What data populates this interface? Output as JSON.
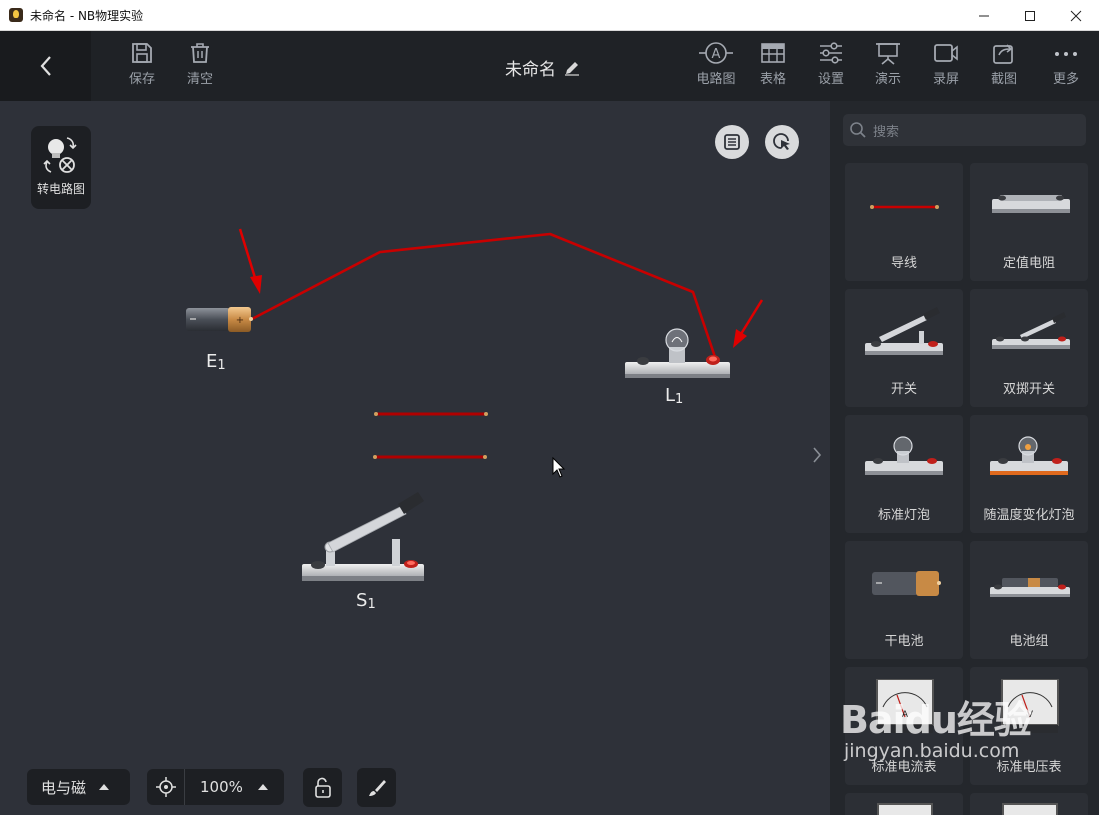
{
  "window": {
    "title": "未命名 - NB物理实验",
    "minimize": "—",
    "maximize": "☐",
    "close": "✕"
  },
  "toolbar": {
    "left": [
      {
        "label": "保存",
        "icon": "save-icon"
      },
      {
        "label": "清空",
        "icon": "trash-icon"
      }
    ],
    "doc_title": "未命名",
    "right": [
      {
        "label": "电路图",
        "icon": "circuit-diagram-icon"
      },
      {
        "label": "表格",
        "icon": "table-icon"
      },
      {
        "label": "设置",
        "icon": "settings-sliders-icon"
      },
      {
        "label": "演示",
        "icon": "presentation-icon"
      },
      {
        "label": "录屏",
        "icon": "video-record-icon"
      },
      {
        "label": "截图",
        "icon": "screenshot-icon"
      },
      {
        "label": "更多",
        "icon": "more-dots-icon"
      }
    ]
  },
  "canvas": {
    "convert_label": "转电路图",
    "components": {
      "battery": {
        "letter": "E",
        "sub": "1"
      },
      "lamp": {
        "letter": "L",
        "sub": "1"
      },
      "switch": {
        "letter": "S",
        "sub": "1"
      }
    },
    "wire_color": "#c80000",
    "arrow_color": "#e00000"
  },
  "bottom": {
    "category": "电与磁",
    "zoom": "100%"
  },
  "sidebar": {
    "search_placeholder": "搜索",
    "items": [
      {
        "label": "导线"
      },
      {
        "label": "定值电阻"
      },
      {
        "label": "开关"
      },
      {
        "label": "双掷开关"
      },
      {
        "label": "标准灯泡"
      },
      {
        "label": "随温度变化灯泡"
      },
      {
        "label": "干电池"
      },
      {
        "label": "电池组"
      },
      {
        "label": "标准电流表"
      },
      {
        "label": "标准电压表"
      }
    ]
  },
  "watermark": {
    "brand": "Baidu经验",
    "url": "jingyan.baidu.com"
  }
}
